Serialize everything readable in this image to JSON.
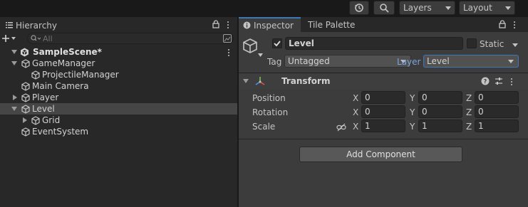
{
  "toolbar": {
    "history_icon": "history-icon",
    "search_icon": "search-icon",
    "layers_label": "Layers",
    "layout_label": "Layout"
  },
  "hierarchy": {
    "tab_label": "Hierarchy",
    "search_placeholder": "All",
    "scene_name": "SampleScene*",
    "items": [
      {
        "label": "GameManager",
        "depth": 1,
        "expander": "expanded",
        "selected": false
      },
      {
        "label": "ProjectileManager",
        "depth": 2,
        "expander": "none",
        "selected": false
      },
      {
        "label": "Main Camera",
        "depth": 1,
        "expander": "none",
        "selected": false
      },
      {
        "label": "Player",
        "depth": 1,
        "expander": "collapsed",
        "selected": false
      },
      {
        "label": "Level",
        "depth": 1,
        "expander": "expanded",
        "selected": true
      },
      {
        "label": "Grid",
        "depth": 2,
        "expander": "collapsed",
        "selected": false
      },
      {
        "label": "EventSystem",
        "depth": 1,
        "expander": "none",
        "selected": false
      }
    ]
  },
  "inspector": {
    "tabs": [
      {
        "label": "Inspector",
        "active": true
      },
      {
        "label": "Tile Palette",
        "active": false
      }
    ],
    "object": {
      "active": true,
      "name": "Level",
      "static_label": "Static",
      "static": false,
      "tag_label": "Tag",
      "tag_value": "Untagged",
      "layer_label": "Layer",
      "layer_value": "Level"
    },
    "transform": {
      "title": "Transform",
      "rows": [
        {
          "label": "Position",
          "x": "0",
          "y": "0",
          "z": "0"
        },
        {
          "label": "Rotation",
          "x": "0",
          "y": "0",
          "z": "0"
        },
        {
          "label": "Scale",
          "x": "1",
          "y": "1",
          "z": "1"
        }
      ],
      "axis_labels": [
        "X",
        "Y",
        "Z"
      ]
    },
    "add_component_label": "Add Component"
  },
  "colors": {
    "accent": "#3a79bb",
    "layer_label": "#7da6d9",
    "selected_row": "#464646"
  }
}
